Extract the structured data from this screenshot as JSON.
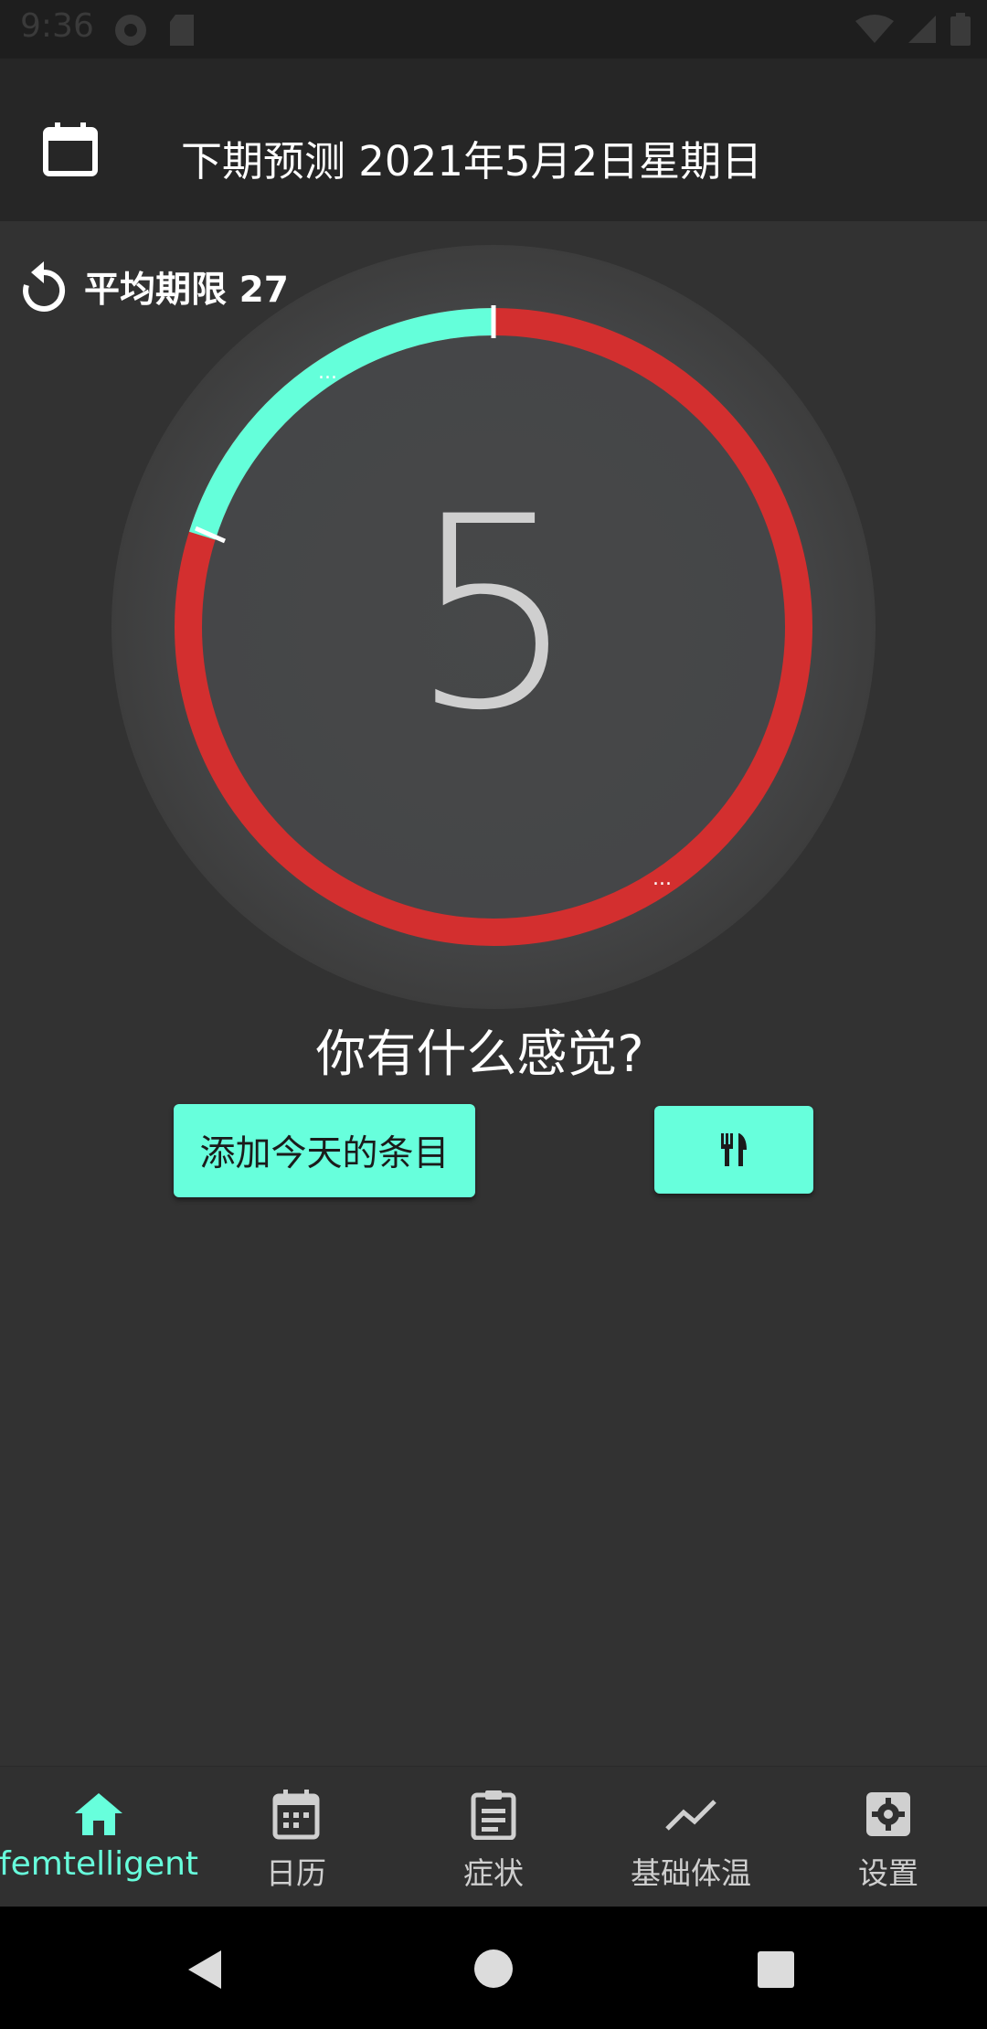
{
  "status_bar": {
    "time": "9:36",
    "left_icons": [
      "circle-app-icon",
      "sd-card-icon"
    ],
    "right_icons": [
      "wifi-icon",
      "signal-icon",
      "battery-icon"
    ]
  },
  "toolbar": {
    "calendar_icon": "calendar-icon",
    "title": "下期预测 2021年5月2日星期日"
  },
  "cycle": {
    "average_label": "平均期限 27",
    "day_number": "5",
    "colors": {
      "red": "#d32f2f",
      "teal": "#64ffda",
      "ring_bg": "#484848"
    }
  },
  "main": {
    "question": "你有什么感觉?",
    "add_entry_button": "添加今天的条目",
    "food_button_icon": "fork-knife-icon"
  },
  "bottom_nav": {
    "items": [
      {
        "label": "femtelligent",
        "icon": "home-icon",
        "active": true
      },
      {
        "label": "日历",
        "icon": "calendar-icon"
      },
      {
        "label": "症状",
        "icon": "clipboard-icon"
      },
      {
        "label": "基础体温",
        "icon": "trend-icon"
      },
      {
        "label": "设置",
        "icon": "settings-icon"
      }
    ]
  },
  "system_nav": [
    "back-icon",
    "home-icon",
    "recents-icon"
  ],
  "theme": {
    "accent": "#67ffdc",
    "background": "#323232",
    "toolbar": "#262626"
  }
}
